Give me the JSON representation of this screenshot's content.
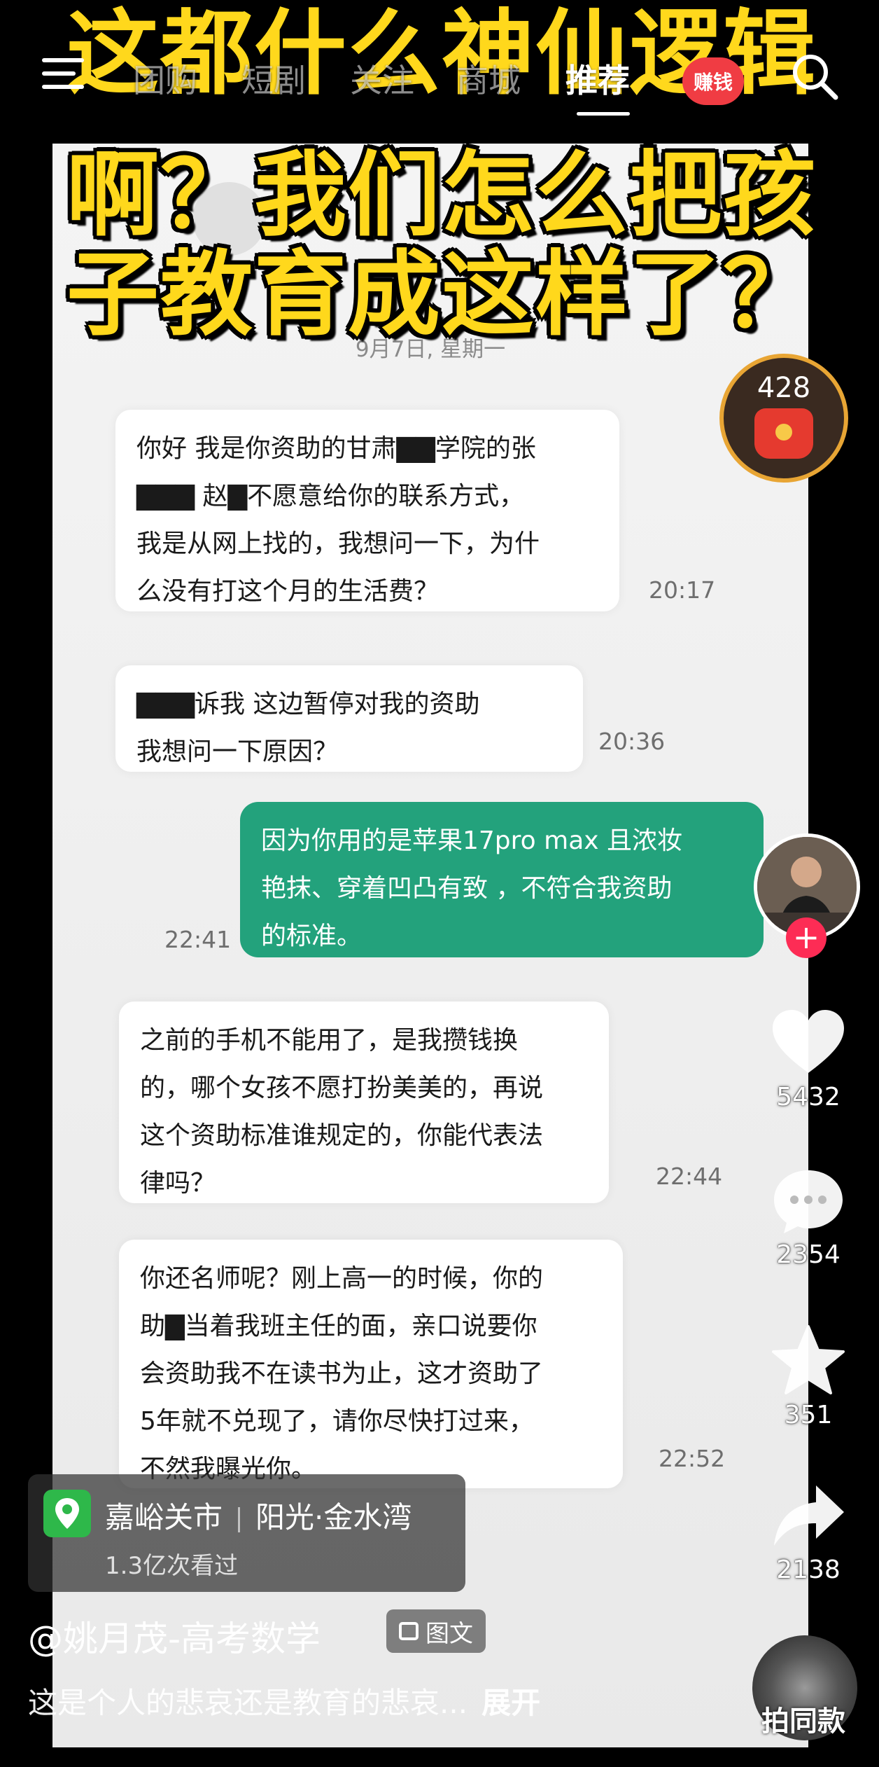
{
  "caption": {
    "lines": [
      "这都什么神仙逻辑",
      "啊？我们怎么把孩",
      "子教育成这样了？"
    ]
  },
  "topnav": {
    "tabs": [
      "团购",
      "短剧",
      "关注",
      "商城",
      "推荐"
    ],
    "active_tab": "推荐",
    "earn_badge": "赚钱"
  },
  "chat": {
    "date": "9月7日, 星期一",
    "messages": [
      {
        "direction": "in",
        "lines": [
          "你好 我是你资助的甘肃▇▇学院的张",
          "▇▇▇ 赵▇不愿意给你的联系方式，",
          "我是从网上找的，我想问一下，为什",
          "么没有打这个月的生活费？"
        ],
        "time": "20:17"
      },
      {
        "direction": "in",
        "lines": [
          "▇▇▇诉我 这边暂停对我的资助",
          "我想问一下原因？"
        ],
        "time": "20:36"
      },
      {
        "direction": "out",
        "lines": [
          "因为你用的是苹果17pro max 且浓妆",
          "艳抹、穿着凹凸有致 ，不符合我资助",
          "的标准。"
        ],
        "time": "22:41"
      },
      {
        "direction": "in",
        "lines": [
          "之前的手机不能用了，是我攒钱换",
          "的，哪个女孩不愿打扮美美的，再说",
          "这个资助标准谁规定的，你能代表法",
          "律吗？"
        ],
        "time": "22:44"
      },
      {
        "direction": "in",
        "lines": [
          "你还名师呢？刚上高一的时候，你的",
          "助▇当着我班主任的面，亲口说要你",
          "会资助我不在读书为止，这才资助了",
          "5年就不兑现了，请你尽快打过来，",
          "不然我曝光你。"
        ],
        "time": "22:52"
      }
    ]
  },
  "red_packet": {
    "count": "428"
  },
  "actions": {
    "likes": "5432",
    "comments": "2354",
    "favorites": "351",
    "shares": "2138"
  },
  "location": {
    "city": "嘉峪关市",
    "place": "阳光·金水湾",
    "views": "1.3亿次看过"
  },
  "post": {
    "author": "@姚月茂-高考数学",
    "type_tag": "图文",
    "description": "这是个人的悲哀还是教育的悲哀...",
    "expand": "展开"
  },
  "music": {
    "label": "拍同款"
  },
  "colors": {
    "caption_yellow": "#ffd81c",
    "outgoing_bubble": "#23a27c",
    "follow_red": "#fd2c55",
    "location_green": "#2eb84a"
  }
}
